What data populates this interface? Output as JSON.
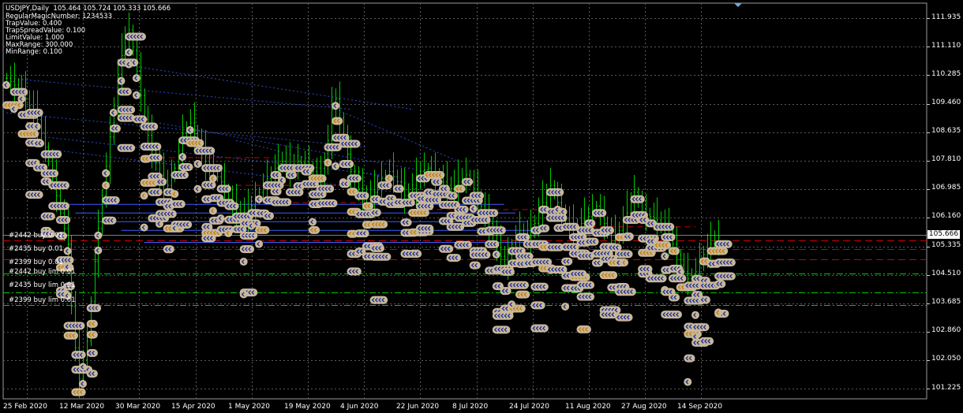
{
  "header": {
    "symbol_line": "USDJPY,Daily  105.464 105.724 105.333 105.666",
    "params": [
      "RegularMagicNumber: 1234533",
      "TrapValue: 0.400",
      "TrapSpreadValue: 0.100",
      "LimitValue: 1.000",
      "MaxRange: 300.000",
      "MinRange: 0.100"
    ]
  },
  "price_axis": {
    "labels": [
      "111.935",
      "111.110",
      "110.285",
      "109.460",
      "108.635",
      "107.810",
      "106.985",
      "106.160",
      "105.335",
      "104.510",
      "103.685",
      "102.860",
      "102.050",
      "101.225"
    ],
    "current_price": "105.666"
  },
  "time_axis": {
    "labels": [
      "25 Feb 2020",
      "12 Mar 2020",
      "30 Mar 2020",
      "15 Apr 2020",
      "1 May 2020",
      "19 May 2020",
      "4 Jun 2020",
      "22 Jun 2020",
      "8 Jul 2020",
      "24 Jul 2020",
      "11 Aug 2020",
      "27 Aug 2020",
      "14 Sep 2020"
    ]
  },
  "order_labels": [
    "#2442 buy 0.01",
    "#2435 buy 0.01",
    "#2399 buy 0.01",
    "#2442 buy lim 0.01",
    "#2435 buy lim 0.01",
    "#2399 buy lim 0.01"
  ],
  "colors": {
    "background": "#000000",
    "grid": "#5a5a5a",
    "candle": "#00c800",
    "marker_fill": "#c8b89a",
    "marker_glyph": "#1e2d9a",
    "marker_glyph_alt": "#c87a00",
    "buy_line": "#3a5cff",
    "trap_line": "#c80000",
    "green_dash": "#00c800"
  },
  "chart_data": {
    "type": "candlestick",
    "symbol": "USDJPY",
    "timeframe": "Daily",
    "last_bar": {
      "open": 105.464,
      "high": 105.724,
      "low": 105.333,
      "close": 105.666
    },
    "ylim": [
      100.8,
      112.3
    ],
    "y_ticks": [
      111.935,
      111.11,
      110.285,
      109.46,
      108.635,
      107.81,
      106.985,
      106.16,
      105.335,
      104.51,
      103.685,
      102.86,
      102.05,
      101.225
    ],
    "x_tick_labels": [
      "25 Feb 2020",
      "12 Mar 2020",
      "30 Mar 2020",
      "15 Apr 2020",
      "1 May 2020",
      "19 May 2020",
      "4 Jun 2020",
      "22 Jun 2020",
      "8 Jul 2020",
      "24 Jul 2020",
      "11 Aug 2020",
      "27 Aug 2020",
      "14 Sep 2020"
    ],
    "close_path": [
      [
        0,
        110.2
      ],
      [
        4,
        109.8
      ],
      [
        8,
        109.0
      ],
      [
        11,
        107.8
      ],
      [
        14,
        106.3
      ],
      [
        16,
        105.4
      ],
      [
        17,
        103.6
      ],
      [
        18,
        102.4
      ],
      [
        19,
        101.5
      ],
      [
        21,
        102.6
      ],
      [
        23,
        104.9
      ],
      [
        25,
        106.8
      ],
      [
        27,
        108.5
      ],
      [
        29,
        110.3
      ],
      [
        31,
        111.4
      ],
      [
        32,
        111.6
      ],
      [
        34,
        110.4
      ],
      [
        36,
        109.0
      ],
      [
        38,
        108.1
      ],
      [
        40,
        107.4
      ],
      [
        42,
        107.1
      ],
      [
        44,
        107.6
      ],
      [
        46,
        108.6
      ],
      [
        48,
        108.9
      ],
      [
        50,
        108.3
      ],
      [
        52,
        107.8
      ],
      [
        54,
        107.5
      ],
      [
        56,
        107.2
      ],
      [
        58,
        106.7
      ],
      [
        60,
        106.4
      ],
      [
        62,
        106.2
      ],
      [
        64,
        106.5
      ],
      [
        66,
        106.9
      ],
      [
        68,
        107.3
      ],
      [
        70,
        107.6
      ],
      [
        72,
        107.8
      ],
      [
        74,
        107.6
      ],
      [
        76,
        107.8
      ],
      [
        78,
        107.7
      ],
      [
        80,
        107.5
      ],
      [
        82,
        107.2
      ],
      [
        84,
        108.4
      ],
      [
        85,
        109.3
      ],
      [
        86,
        109.6
      ],
      [
        88,
        108.5
      ],
      [
        90,
        107.5
      ],
      [
        92,
        107.0
      ],
      [
        94,
        106.7
      ],
      [
        96,
        106.9
      ],
      [
        98,
        107.3
      ],
      [
        100,
        107.5
      ],
      [
        102,
        107.2
      ],
      [
        104,
        106.8
      ],
      [
        106,
        107.0
      ],
      [
        108,
        107.5
      ],
      [
        110,
        107.6
      ],
      [
        112,
        107.4
      ],
      [
        114,
        107.2
      ],
      [
        116,
        107.0
      ],
      [
        118,
        107.2
      ],
      [
        120,
        107.4
      ],
      [
        122,
        107.0
      ],
      [
        124,
        106.5
      ],
      [
        126,
        106.0
      ],
      [
        128,
        105.3
      ],
      [
        130,
        104.8
      ],
      [
        132,
        105.4
      ],
      [
        134,
        105.8
      ],
      [
        136,
        105.6
      ],
      [
        138,
        106.0
      ],
      [
        140,
        106.6
      ],
      [
        142,
        107.1
      ],
      [
        144,
        106.6
      ],
      [
        146,
        106.1
      ],
      [
        148,
        105.8
      ],
      [
        150,
        106.0
      ],
      [
        152,
        106.2
      ],
      [
        154,
        106.5
      ],
      [
        156,
        106.0
      ],
      [
        158,
        105.5
      ],
      [
        160,
        105.8
      ],
      [
        162,
        106.3
      ],
      [
        164,
        106.9
      ],
      [
        166,
        106.3
      ],
      [
        168,
        106.2
      ],
      [
        170,
        106.1
      ],
      [
        172,
        105.8
      ],
      [
        174,
        105.4
      ],
      [
        176,
        104.8
      ],
      [
        178,
        104.4
      ],
      [
        180,
        104.6
      ],
      [
        182,
        105.1
      ],
      [
        184,
        105.4
      ],
      [
        186,
        105.6
      ]
    ],
    "horizontal_levels": [
      105.5,
      105.25,
      104.95,
      104.55,
      104.0,
      103.65
    ]
  }
}
